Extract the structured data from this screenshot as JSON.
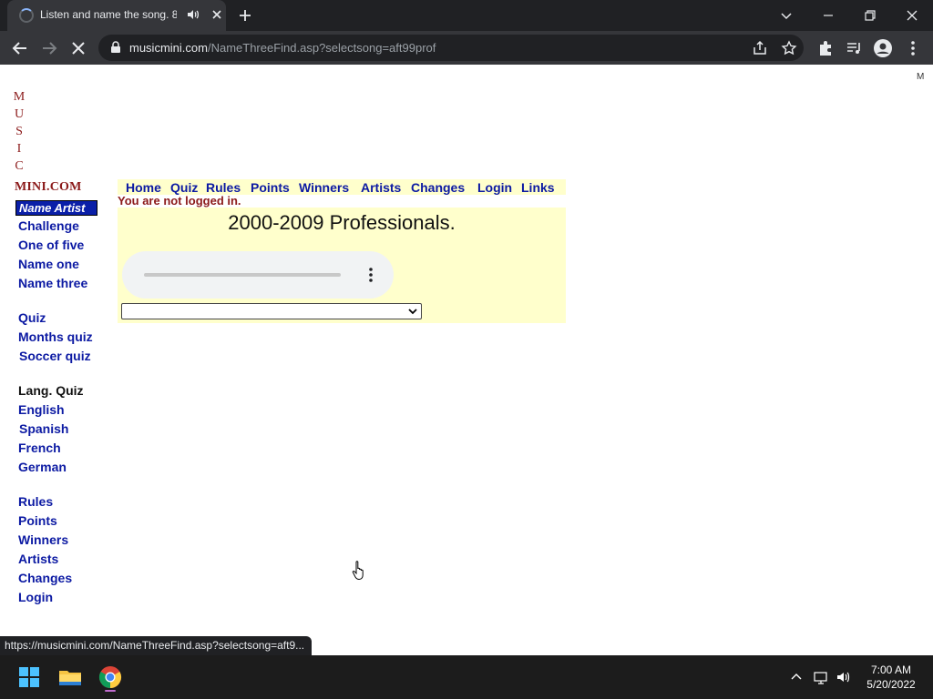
{
  "browser": {
    "tab_title": "Listen and name the song. 8(",
    "address_host": "musicmini.com",
    "address_path": "/NameThreeFind.asp?selectsong=aft99prof"
  },
  "page": {
    "corner_text": "M",
    "logo_vertical": [
      "M",
      "U",
      "S",
      "I",
      "C"
    ],
    "logo_text": "MINI.COM",
    "name_artist_label": "Name Artist",
    "sidebar": {
      "challenge": "Challenge",
      "one_of_five": "One of five",
      "name_one": "Name one",
      "name_three": "Name three",
      "quiz": "Quiz",
      "months_quiz": "Months quiz",
      "soccer_quiz": "Soccer quiz",
      "lang_quiz_heading": "Lang. Quiz",
      "english": "English",
      "spanish": "Spanish",
      "french": "French",
      "german": "German",
      "rules": "Rules",
      "points": "Points",
      "winners": "Winners",
      "artists": "Artists",
      "changes": "Changes",
      "login": "Login"
    },
    "topnav": {
      "home": "Home",
      "quiz": "Quiz",
      "rules": "Rules",
      "points": "Points",
      "winners": "Winners",
      "artists": "Artists",
      "changes": "Changes",
      "login": "Login",
      "links": "Links"
    },
    "login_status": "You are not logged in.",
    "panel_title": "2000-2009 Professionals.",
    "song_select_value": ""
  },
  "status_bar_url": "https://musicmini.com/NameThreeFind.asp?selectsong=aft9...",
  "taskbar": {
    "time": "7:00 AM",
    "date": "5/20/2022"
  },
  "colors": {
    "link": "#0c1aa3",
    "logo": "#8b1a1a",
    "panel_bg": "#ffffcc",
    "name_artist_bg": "#0a1fa8"
  }
}
